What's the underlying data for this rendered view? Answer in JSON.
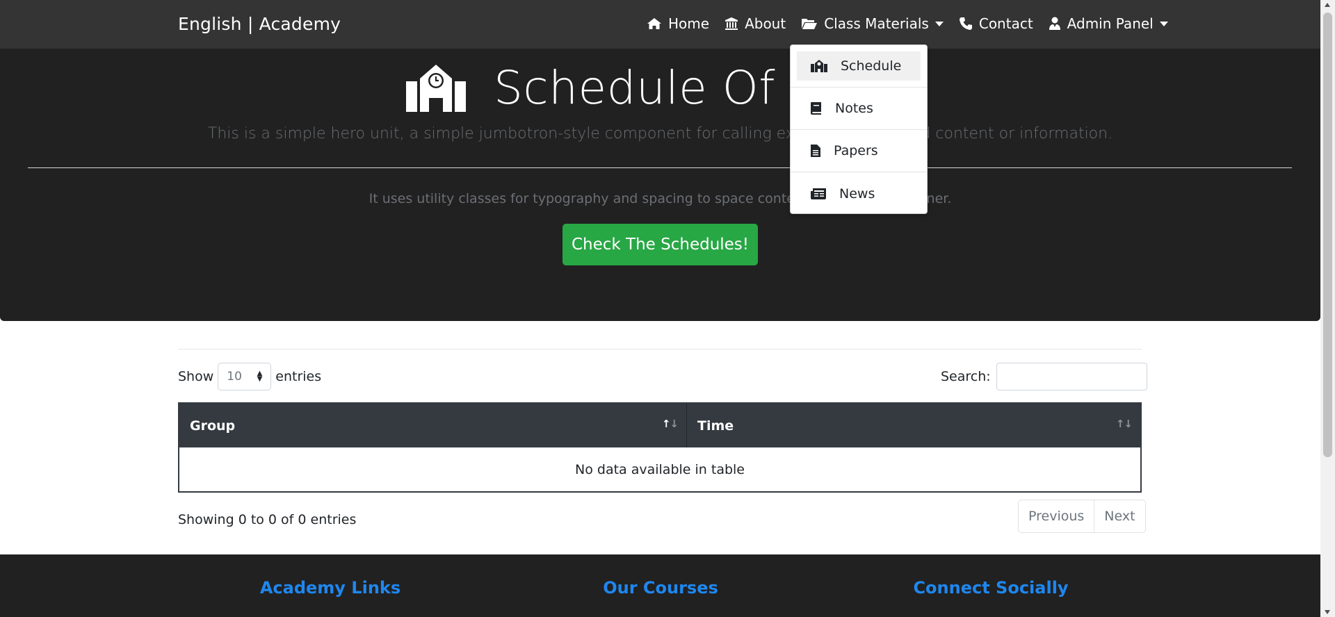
{
  "navbar": {
    "brand": "English | Academy",
    "items": [
      {
        "label": "Home",
        "icon": "home-icon"
      },
      {
        "label": "About",
        "icon": "university-icon"
      },
      {
        "label": "Class Materials",
        "icon": "folder-open-icon",
        "dropdown": true
      },
      {
        "label": "Contact",
        "icon": "phone-icon"
      },
      {
        "label": "Admin Panel",
        "icon": "user-tie-icon",
        "dropdown": true
      }
    ],
    "dropdown": {
      "items": [
        {
          "label": "Schedule",
          "icon": "school-icon"
        },
        {
          "label": "Notes",
          "icon": "book-icon"
        },
        {
          "label": "Papers",
          "icon": "file-alt-icon"
        },
        {
          "label": "News",
          "icon": "newspaper-icon"
        }
      ]
    }
  },
  "hero": {
    "title": "Schedule Of Cl",
    "lead": "This is a simple hero unit, a simple jumbotron-style component for calling extra a",
    "lead_tail": "d content or information.",
    "sub": "It uses utility classes for typography and spacing to space content out",
    "sub_tail": "ainer.",
    "button_label": "Check The Schedules!"
  },
  "table": {
    "length_prefix": "Show",
    "length_value": "10",
    "length_suffix": "entries",
    "search_label": "Search:",
    "search_value": "",
    "columns": [
      "Group",
      "Time"
    ],
    "empty_message": "No data available in table",
    "info": "Showing 0 to 0 of 0 entries",
    "paging": {
      "previous": "Previous",
      "next": "Next"
    }
  },
  "footer": {
    "columns": [
      "Academy Links",
      "Our Courses",
      "Connect Socially"
    ]
  },
  "colors": {
    "navbar_bg": "#343434",
    "hero_bg": "#212121",
    "button_green": "#28a745",
    "table_head": "#343a40",
    "footer_heading": "#1e87f0"
  }
}
